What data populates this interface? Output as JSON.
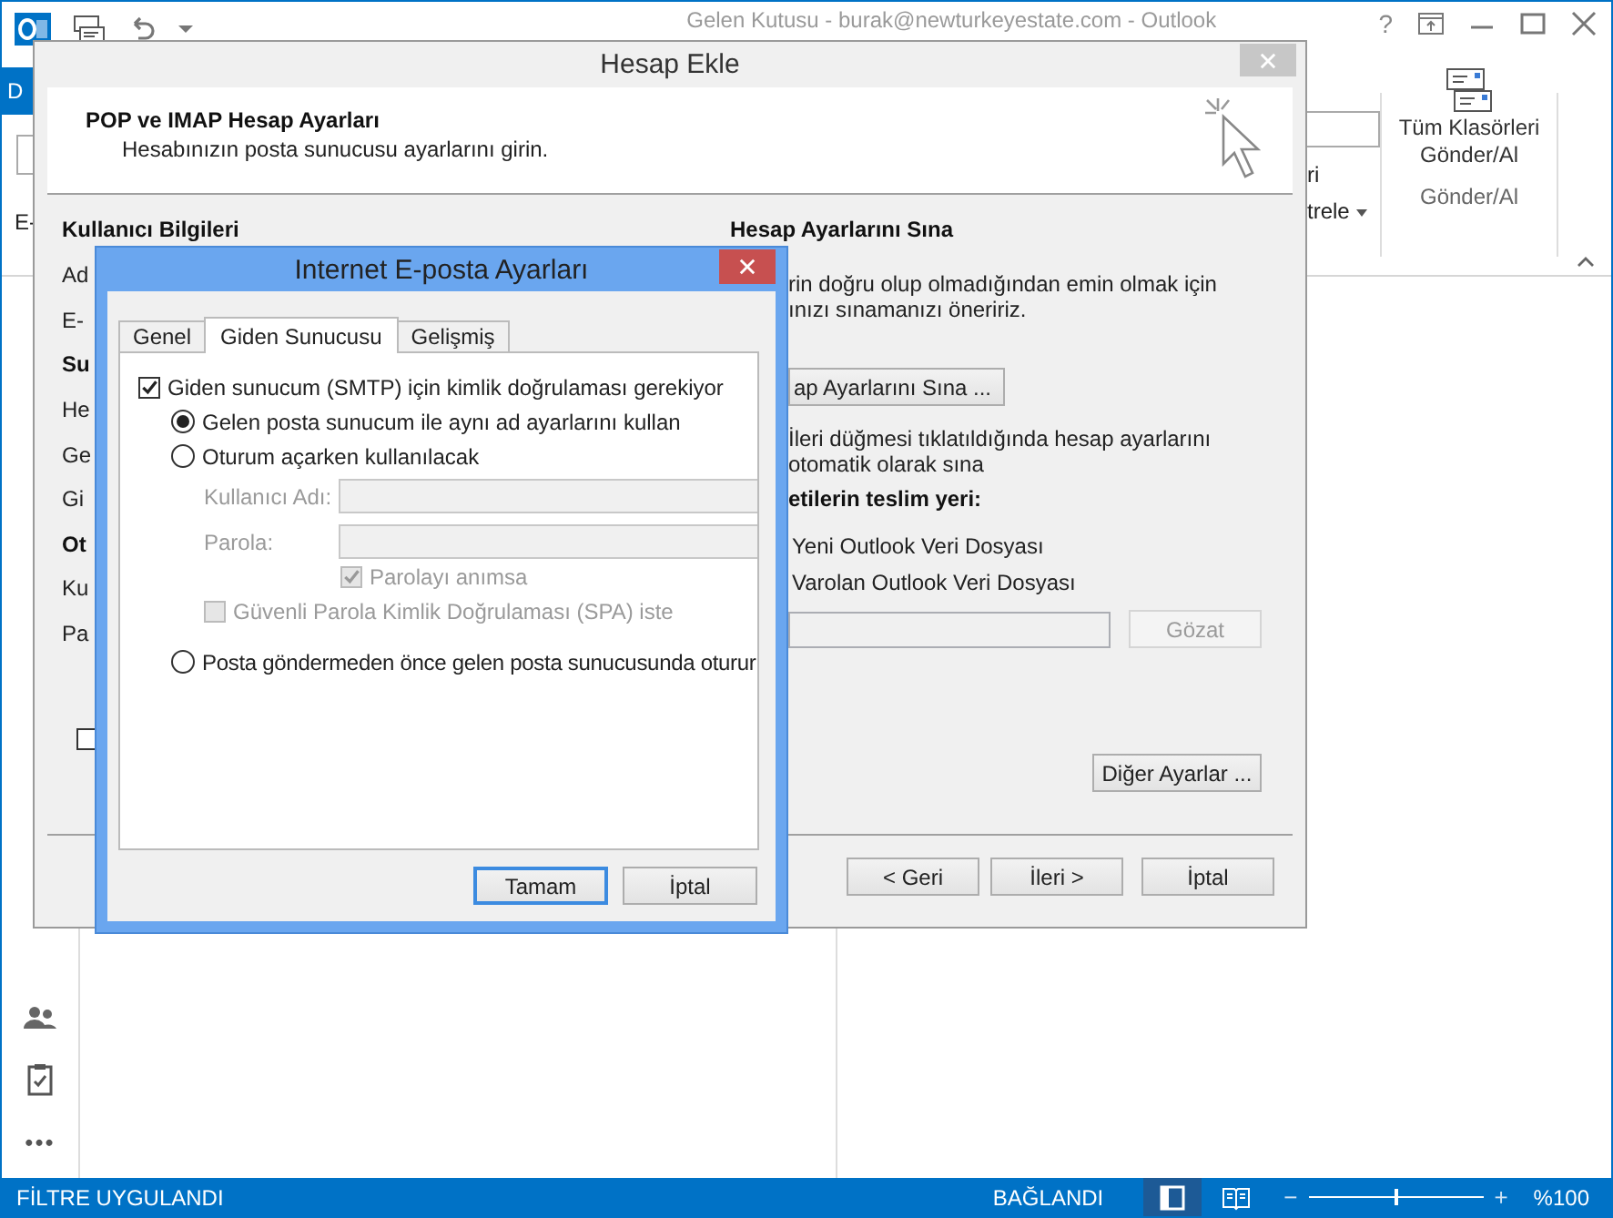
{
  "outlook": {
    "title": "Gelen Kutusu - burak@newturkeyestate.com - Outlook",
    "help": "?",
    "file_tab": "D",
    "left_fragment": "E-",
    "ribbon": {
      "fragments": [
        {
          "text": "ri",
          "dropdown": false
        },
        {
          "text": "trele",
          "dropdown": true
        }
      ],
      "send_receive_button": "Tüm Klasörleri Gönder/Al",
      "group_label": "Gönder/Al"
    },
    "nav": {
      "more": "•••"
    }
  },
  "status_bar": {
    "filter": "FİLTRE UYGULANDI",
    "connection": "BAĞLANDI",
    "zoom": {
      "out": "−",
      "in": "+",
      "level": 0.5,
      "reading": "%100"
    }
  },
  "account_dialog": {
    "title": "Hesap Ekle",
    "header": {
      "title": "POP ve IMAP Hesap Ayarları",
      "subtitle": "Hesabınızın posta sunucusu ayarlarını girin."
    },
    "user_info": {
      "heading": "Kullanıcı Bilgileri",
      "labels": [
        {
          "text": "Ad",
          "kind": "label"
        },
        {
          "text": "E-",
          "kind": "label"
        },
        {
          "text": "Su",
          "kind": "heading"
        },
        {
          "text": "He",
          "kind": "label"
        },
        {
          "text": "Ge",
          "kind": "label"
        },
        {
          "text": "Gi",
          "kind": "label"
        },
        {
          "text": "Ot",
          "kind": "heading"
        },
        {
          "text": "Ku",
          "kind": "label"
        },
        {
          "text": "Pa",
          "kind": "label"
        }
      ],
      "checkbox": {
        "checked": false
      }
    },
    "test": {
      "heading": "Hesap Ayarlarını Sına",
      "lines": [
        "rin doğru olup olmadığından emin olmak için",
        "ınızı sınamanızı öneririz."
      ],
      "button": "ap Ayarlarını Sına ...",
      "auto_lines": [
        "İleri düğmesi tıklatıldığında hesap ayarlarını",
        "otomatik olarak sına"
      ],
      "delivery_heading": "etilerin teslim yeri:",
      "delivery_options": [
        "Yeni Outlook Veri Dosyası",
        "Varolan Outlook Veri Dosyası"
      ],
      "browse": {
        "label": "Gözat",
        "disabled": true
      },
      "more_settings": "Diğer Ayarlar ..."
    },
    "buttons": [
      "< Geri",
      "İleri >",
      "İptal"
    ]
  },
  "internet_dialog": {
    "title": "Internet E-posta Ayarları",
    "tabs": [
      {
        "label": "Genel",
        "selected": false
      },
      {
        "label": "Giden Sunucusu",
        "selected": true
      },
      {
        "label": "Gelişmiş",
        "selected": false
      }
    ],
    "require_auth": {
      "label": "Giden sunucum (SMTP) için kimlik doğrulaması gerekiyor",
      "checked": true
    },
    "auth_methods": [
      {
        "label": "Gelen posta sunucum ile aynı ad ayarlarını kullan",
        "selected": true
      },
      {
        "label": "Oturum açarken kullanılacak",
        "selected": false
      },
      {
        "label": "Posta göndermeden önce gelen posta sunucusunda oturur",
        "selected": false
      }
    ],
    "fields": [
      {
        "label": "Kullanıcı Adı:",
        "disabled": true
      },
      {
        "label": "Parola:",
        "disabled": true
      }
    ],
    "remember": {
      "label": "Parolayı anımsa",
      "checked": true,
      "disabled": true
    },
    "spa": {
      "label": "Güvenli Parola Kimlik Doğrulaması (SPA) iste",
      "checked": false,
      "disabled": true
    },
    "buttons": [
      {
        "label": "Tamam",
        "focused": true
      },
      {
        "label": "İptal",
        "focused": false
      }
    ]
  }
}
